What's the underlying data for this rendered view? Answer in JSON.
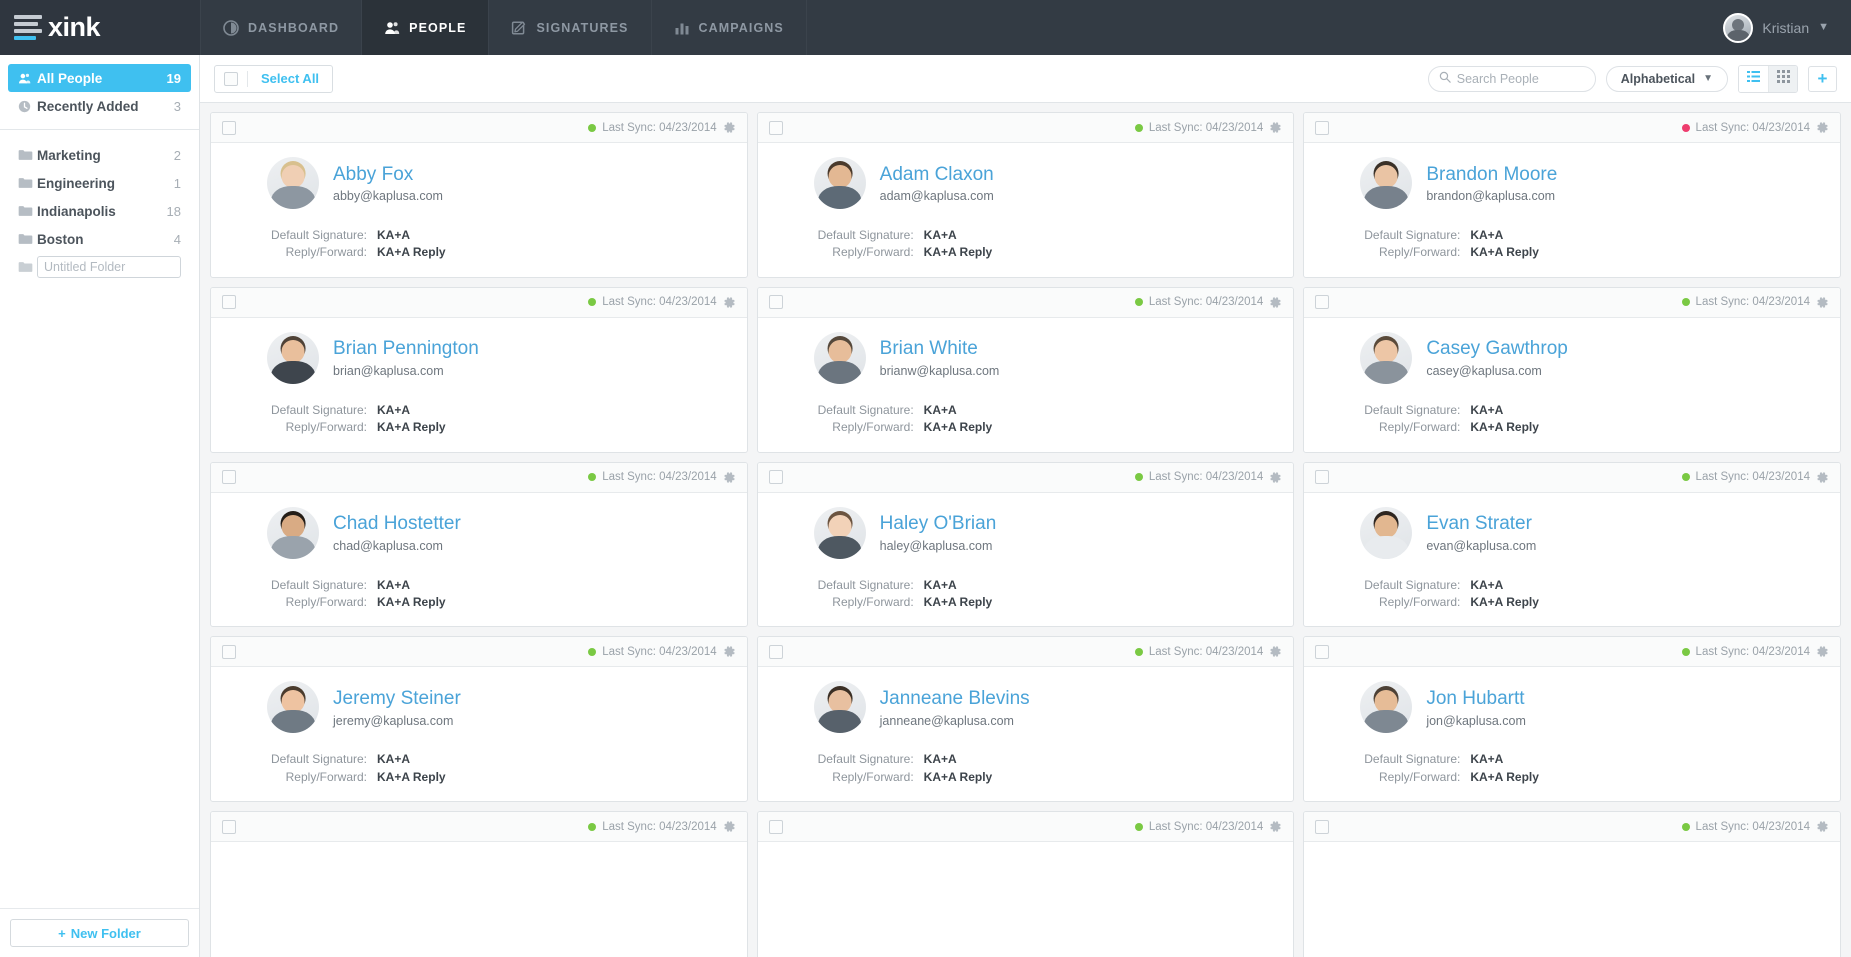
{
  "brand": {
    "logo_text": "xink",
    "accent": "#3fc0f0"
  },
  "topnav": {
    "items": [
      {
        "label": "DASHBOARD",
        "icon": "dashboard-icon",
        "active": false
      },
      {
        "label": "PEOPLE",
        "icon": "people-icon",
        "active": true
      },
      {
        "label": "SIGNATURES",
        "icon": "signatures-icon",
        "active": false
      },
      {
        "label": "CAMPAIGNS",
        "icon": "campaigns-icon",
        "active": false
      }
    ],
    "user": {
      "name": "Kristian",
      "chevron": "▼"
    }
  },
  "sidebar": {
    "primary": [
      {
        "label": "All People",
        "count": "19",
        "icon": "people-icon",
        "active": true
      },
      {
        "label": "Recently Added",
        "count": "3",
        "icon": "clock-icon",
        "active": false
      }
    ],
    "folders": [
      {
        "label": "Marketing",
        "count": "2"
      },
      {
        "label": "Engineering",
        "count": "1"
      },
      {
        "label": "Indianapolis",
        "count": "18"
      },
      {
        "label": "Boston",
        "count": "4"
      }
    ],
    "new_folder_placeholder": "Untitled Folder",
    "new_folder_value": "",
    "new_folder_button": "New Folder",
    "new_folder_plus": "+"
  },
  "toolbar": {
    "select_all_label": "Select All",
    "search_placeholder": "Search People",
    "search_value": "",
    "sort_label": "Alphabetical",
    "sort_chevron": "▼",
    "view_list_icon": "list-view-icon",
    "view_grid_icon": "grid-view-icon",
    "view_active": "grid",
    "add_label": "+"
  },
  "card_labels": {
    "sync_prefix": "Last Sync: ",
    "default_signature": "Default Signature:",
    "reply_forward": "Reply/Forward:"
  },
  "people": [
    {
      "name": "Abby Fox",
      "email": "abby@kaplusa.com",
      "sync": "Last Sync: 04/23/2014",
      "status_color": "#7ac943",
      "signature": "KA+A",
      "reply": "KA+A Reply",
      "skin": "#f0cfb4",
      "hair": "#d8c08e",
      "shirt": "#8d97a1"
    },
    {
      "name": "Adam Claxon",
      "email": "adam@kaplusa.com",
      "sync": "Last Sync: 04/23/2014",
      "status_color": "#7ac943",
      "signature": "KA+A",
      "reply": "KA+A Reply",
      "skin": "#e3b893",
      "hair": "#4a3a2c",
      "shirt": "#5d6a76"
    },
    {
      "name": "Brandon Moore",
      "email": "brandon@kaplusa.com",
      "sync": "Last Sync: 04/23/2014",
      "status_color": "#ee3d6e",
      "signature": "KA+A",
      "reply": "KA+A Reply",
      "skin": "#eac4a4",
      "hair": "#3a3128",
      "shirt": "#77818c"
    },
    {
      "name": "Brian Pennington",
      "email": "brian@kaplusa.com",
      "sync": "Last Sync: 04/23/2014",
      "status_color": "#7ac943",
      "signature": "KA+A",
      "reply": "KA+A Reply",
      "skin": "#e9bf9c",
      "hair": "#4f4237",
      "shirt": "#3e454d"
    },
    {
      "name": "Brian White",
      "email": "brianw@kaplusa.com",
      "sync": "Last Sync: 04/23/2014",
      "status_color": "#7ac943",
      "signature": "KA+A",
      "reply": "KA+A Reply",
      "skin": "#e7bd9a",
      "hair": "#55483b",
      "shirt": "#6b757f"
    },
    {
      "name": "Casey Gawthrop",
      "email": "casey@kaplusa.com",
      "sync": "Last Sync: 04/23/2014",
      "status_color": "#7ac943",
      "signature": "KA+A",
      "reply": "KA+A Reply",
      "skin": "#edc6a6",
      "hair": "#5a4a3a",
      "shirt": "#8a939c"
    },
    {
      "name": "Chad Hostetter",
      "email": "chad@kaplusa.com",
      "sync": "Last Sync: 04/23/2014",
      "status_color": "#7ac943",
      "signature": "KA+A",
      "reply": "KA+A Reply",
      "skin": "#d9ab84",
      "hair": "#241d17",
      "shirt": "#9aa3ac"
    },
    {
      "name": "Haley O'Brian",
      "email": "haley@kaplusa.com",
      "sync": "Last Sync: 04/23/2014",
      "status_color": "#7ac943",
      "signature": "KA+A",
      "reply": "KA+A Reply",
      "skin": "#f2d2b8",
      "hair": "#6b5440",
      "shirt": "#4e5861"
    },
    {
      "name": "Evan Strater",
      "email": "evan@kaplusa.com",
      "sync": "Last Sync: 04/23/2014",
      "status_color": "#7ac943",
      "signature": "KA+A",
      "reply": "KA+A Reply",
      "skin": "#e2b790",
      "hair": "#2e2620",
      "shirt": "#e8ebee"
    },
    {
      "name": "Jeremy Steiner",
      "email": "jeremy@kaplusa.com",
      "sync": "Last Sync: 04/23/2014",
      "status_color": "#7ac943",
      "signature": "KA+A",
      "reply": "KA+A Reply",
      "skin": "#eec3a1",
      "hair": "#4a3b2d",
      "shirt": "#6f7a84"
    },
    {
      "name": "Janneane Blevins",
      "email": "janneane@kaplusa.com",
      "sync": "Last Sync: 04/23/2014",
      "status_color": "#7ac943",
      "signature": "KA+A",
      "reply": "KA+A Reply",
      "skin": "#e8c0a0",
      "hair": "#3b2f25",
      "shirt": "#57616b"
    },
    {
      "name": "Jon Hubartt",
      "email": "jon@kaplusa.com",
      "sync": "Last Sync: 04/23/2014",
      "status_color": "#7ac943",
      "signature": "KA+A",
      "reply": "KA+A Reply",
      "skin": "#e6bc97",
      "hair": "#4d4136",
      "shirt": "#7e8892"
    }
  ],
  "partial_row": [
    {
      "sync": "Last Sync: 04/23/2014",
      "status_color": "#7ac943"
    },
    {
      "sync": "Last Sync: 04/23/2014",
      "status_color": "#7ac943"
    },
    {
      "sync": "Last Sync: 04/23/2014",
      "status_color": "#7ac943"
    }
  ]
}
